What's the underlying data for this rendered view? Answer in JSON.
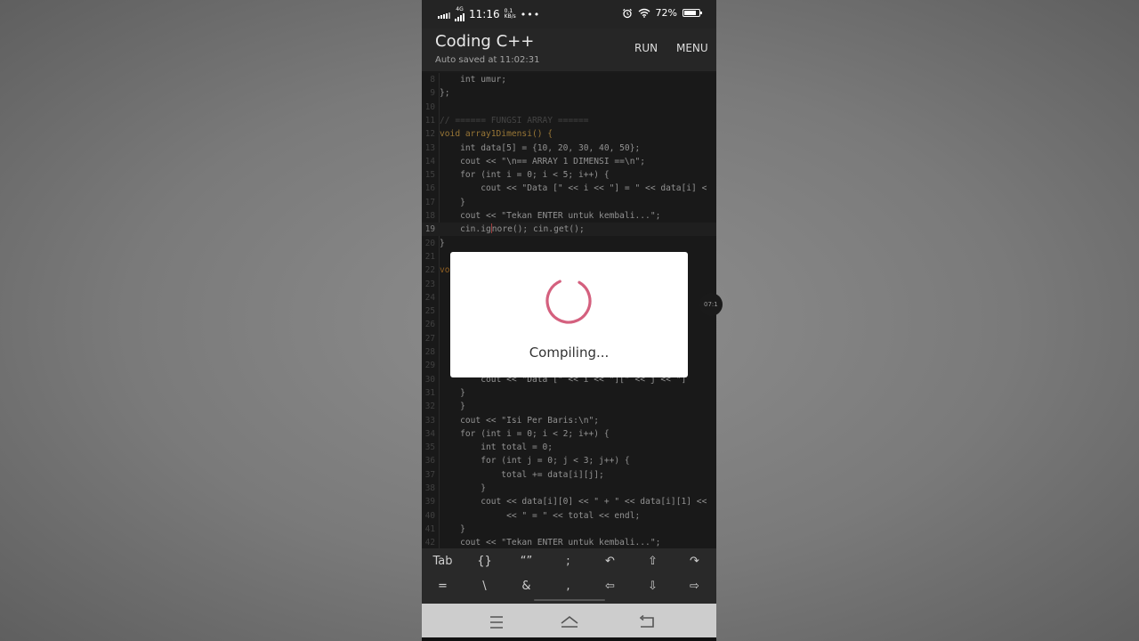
{
  "status_bar": {
    "time": "11:16",
    "network": "4G",
    "speed_value": "0.1",
    "speed_unit": "KB/s",
    "battery": "72%",
    "icons": [
      "signal-icon",
      "alarm-icon",
      "wifi-icon",
      "battery-icon"
    ]
  },
  "app_bar": {
    "title": "Coding C++",
    "subtitle": "Auto saved at 11:02:31",
    "run_label": "RUN",
    "menu_label": "MENU"
  },
  "editor": {
    "active_line": "19",
    "lines": [
      {
        "n": "8"
      },
      {
        "n": "9"
      },
      {
        "n": "10"
      },
      {
        "n": "11"
      },
      {
        "n": "12"
      },
      {
        "n": "13"
      },
      {
        "n": "14"
      },
      {
        "n": "15"
      },
      {
        "n": "16"
      },
      {
        "n": "17"
      },
      {
        "n": "18"
      },
      {
        "n": "19"
      },
      {
        "n": "20"
      },
      {
        "n": "21"
      },
      {
        "n": "22"
      },
      {
        "n": "23"
      },
      {
        "n": "24"
      },
      {
        "n": "25"
      },
      {
        "n": "26"
      },
      {
        "n": "27"
      },
      {
        "n": "28"
      },
      {
        "n": "29"
      },
      {
        "n": "30"
      },
      {
        "n": "31"
      },
      {
        "n": "32"
      },
      {
        "n": "33"
      },
      {
        "n": "34"
      },
      {
        "n": "35"
      },
      {
        "n": "36"
      },
      {
        "n": "37"
      },
      {
        "n": "38"
      },
      {
        "n": "39"
      },
      {
        "n": "40"
      },
      {
        "n": "41"
      },
      {
        "n": "42"
      }
    ],
    "code": {
      "l8": "    int umur;",
      "l9": "};",
      "l11": "// ====== FUNGSI ARRAY ======",
      "l12": "void array1Dimensi() {",
      "l13": "    int data[5] = {10, 20, 30, 40, 50};",
      "l14": "    cout << \"\\n== ARRAY 1 DIMENSI ==\\n\";",
      "l15": "    for (int i = 0; i < 5; i++) {",
      "l16": "        cout << \"Data [\" << i << \"] = \" << data[i] <",
      "l17": "    }",
      "l18": "    cout << \"Tekan ENTER untuk kembali...\";",
      "l19a": "    cin.ig",
      "l19b": "nore(); cin.get();",
      "l20": "}",
      "l22": "vo",
      "l30": "        cout << \"Data [\" << i << \"][\" << j << \"]",
      "l31": "    }",
      "l32": "    }",
      "l33": "    cout << \"Isi Per Baris:\\n\";",
      "l34": "    for (int i = 0; i < 2; i++) {",
      "l35": "        int total = 0;",
      "l36": "        for (int j = 0; j < 3; j++) {",
      "l37": "            total += data[i][j];",
      "l38": "        }",
      "l39": "        cout << data[i][0] << \" + \" << data[i][1] <<",
      "l40": "             << \" = \" << total << endl;",
      "l41": "    }",
      "l42": "    cout << \"Tekan ENTER untuk kembali...\";"
    }
  },
  "dialog": {
    "message": "Compiling...",
    "spinner_color": "#d4607e"
  },
  "side_bubble": {
    "text": "07:1"
  },
  "accessory_keys": {
    "row1": [
      "Tab",
      "{}",
      "“”",
      ";",
      "undo-icon",
      "shift-up-icon",
      "redo-icon"
    ],
    "row2": [
      "=",
      "\\",
      "&",
      ",",
      "cursor-left-icon",
      "cursor-down-icon",
      "cursor-right-icon"
    ],
    "labels": {
      "tab": "Tab",
      "braces": "{}",
      "quotes": "“”",
      "semicolon": ";",
      "equals": "=",
      "backslash": "\\",
      "ampersand": "&",
      "comma": ","
    }
  },
  "nav_bar": {
    "icons": [
      "menu-icon",
      "home-icon",
      "back-icon"
    ]
  },
  "colors": {
    "editor_bg": "#232323",
    "keyword": "#c8832e",
    "function": "#d3a44b",
    "number": "#6a8fc3",
    "string": "#6e8d5a"
  }
}
